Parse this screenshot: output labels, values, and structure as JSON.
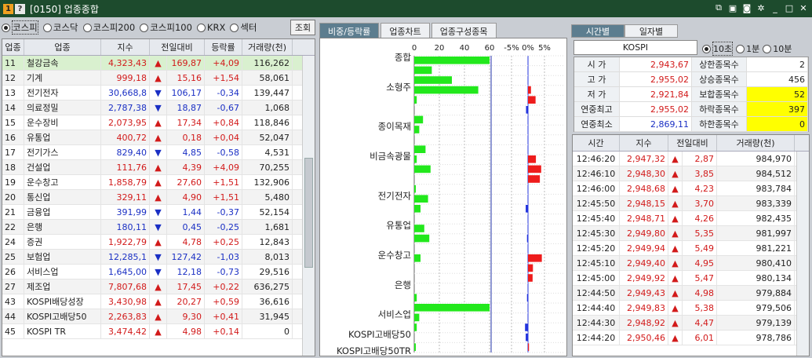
{
  "window": {
    "badge_one": "1",
    "badge_q": "?",
    "title": "[0150] 업종종합"
  },
  "market_radios": [
    {
      "label": "코스피",
      "selected": true
    },
    {
      "label": "코스닥",
      "selected": false
    },
    {
      "label": "코스피200",
      "selected": false
    },
    {
      "label": "코스피100",
      "selected": false
    },
    {
      "label": "KRX",
      "selected": false
    },
    {
      "label": "섹터",
      "selected": false
    }
  ],
  "query_button": "조회",
  "left_table": {
    "headers": [
      "업종",
      "업종",
      "지수",
      "전일대비",
      "등락률",
      "거래량(천)"
    ],
    "rows": [
      {
        "code": "11",
        "name": "철강금속",
        "index": "4,323,43",
        "dir": "up",
        "change": "169,87",
        "rate": "+4,09",
        "volume": "116,262"
      },
      {
        "code": "12",
        "name": "기계",
        "index": "999,18",
        "dir": "up",
        "change": "15,16",
        "rate": "+1,54",
        "volume": "58,061"
      },
      {
        "code": "13",
        "name": "전기전자",
        "index": "30,668,8",
        "dir": "down",
        "change": "106,17",
        "rate": "-0,34",
        "volume": "139,447"
      },
      {
        "code": "14",
        "name": "의료정밀",
        "index": "2,787,38",
        "dir": "down",
        "change": "18,87",
        "rate": "-0,67",
        "volume": "1,068"
      },
      {
        "code": "15",
        "name": "운수장비",
        "index": "2,073,95",
        "dir": "up",
        "change": "17,34",
        "rate": "+0,84",
        "volume": "118,846"
      },
      {
        "code": "16",
        "name": "유통업",
        "index": "400,72",
        "dir": "up",
        "change": "0,18",
        "rate": "+0,04",
        "volume": "52,047"
      },
      {
        "code": "17",
        "name": "전기가스",
        "index": "829,40",
        "dir": "down",
        "change": "4,85",
        "rate": "-0,58",
        "volume": "4,531"
      },
      {
        "code": "18",
        "name": "건설업",
        "index": "111,76",
        "dir": "up",
        "change": "4,39",
        "rate": "+4,09",
        "volume": "70,255"
      },
      {
        "code": "19",
        "name": "운수창고",
        "index": "1,858,79",
        "dir": "up",
        "change": "27,60",
        "rate": "+1,51",
        "volume": "132,906"
      },
      {
        "code": "20",
        "name": "통신업",
        "index": "329,11",
        "dir": "up",
        "change": "4,90",
        "rate": "+1,51",
        "volume": "5,480"
      },
      {
        "code": "21",
        "name": "금융업",
        "index": "391,99",
        "dir": "down",
        "change": "1,44",
        "rate": "-0,37",
        "volume": "52,154"
      },
      {
        "code": "22",
        "name": "은행",
        "index": "180,11",
        "dir": "down",
        "change": "0,45",
        "rate": "-0,25",
        "volume": "1,681"
      },
      {
        "code": "24",
        "name": "증권",
        "index": "1,922,79",
        "dir": "up",
        "change": "4,78",
        "rate": "+0,25",
        "volume": "12,843"
      },
      {
        "code": "25",
        "name": "보험업",
        "index": "12,285,1",
        "dir": "down",
        "change": "127,42",
        "rate": "-1,03",
        "volume": "8,013"
      },
      {
        "code": "26",
        "name": "서비스업",
        "index": "1,645,00",
        "dir": "down",
        "change": "12,18",
        "rate": "-0,73",
        "volume": "29,516"
      },
      {
        "code": "27",
        "name": "제조업",
        "index": "7,807,68",
        "dir": "up",
        "change": "17,45",
        "rate": "+0,22",
        "volume": "636,275"
      },
      {
        "code": "43",
        "name": "KOSPI배당성장",
        "index": "3,430,98",
        "dir": "up",
        "change": "20,27",
        "rate": "+0,59",
        "volume": "36,616"
      },
      {
        "code": "44",
        "name": "KOSPI고배당50",
        "index": "2,263,83",
        "dir": "up",
        "change": "9,30",
        "rate": "+0,41",
        "volume": "31,945"
      },
      {
        "code": "45",
        "name": "KOSPI TR",
        "index": "3,474,42",
        "dir": "up",
        "change": "4,98",
        "rate": "+0,14",
        "volume": "0"
      }
    ]
  },
  "arrows": {
    "up": "▲",
    "down": "▼"
  },
  "mid_tabs": [
    "비중/등락률",
    "업종차트",
    "업종구성종목"
  ],
  "chart_data": {
    "type": "bar",
    "left_axis_ticks": [
      "0",
      "20",
      "40",
      "60"
    ],
    "right_axis_ticks": [
      "-5%",
      "0%",
      "5%"
    ],
    "category_labels": [
      "종합",
      "소형주",
      "종이목재",
      "비금속광물",
      "전기전자",
      "유통업",
      "운수창고",
      "은행",
      "서비스업",
      "KOSPI고배당50",
      "KOSPI고배당50TR"
    ],
    "weight_bars": [
      60,
      14,
      30,
      51,
      2,
      0,
      7,
      4,
      0,
      9,
      2,
      13,
      0,
      1,
      11,
      5,
      0,
      8,
      12,
      0,
      5,
      0,
      0,
      0,
      2,
      60,
      4,
      2,
      0,
      1
    ],
    "rate_bars": [
      0,
      0,
      0,
      0.9,
      2.3,
      -0.6,
      0,
      0,
      0,
      0,
      2.4,
      4.0,
      3.6,
      0,
      0,
      -0.7,
      0,
      0,
      -0.3,
      0,
      4.2,
      1.5,
      1.4,
      0,
      -0.3,
      0,
      0,
      -0.9,
      -0.7,
      0.3
    ]
  },
  "right_tabs": [
    "시간별",
    "일자별"
  ],
  "index_name": "KOSPI",
  "interval_radios": [
    {
      "label": "10초",
      "selected": true
    },
    {
      "label": "1분",
      "selected": false
    },
    {
      "label": "10분",
      "selected": false
    }
  ],
  "summary": [
    {
      "label": "시 가",
      "value": "2,943,67",
      "color": "up",
      "label2": "상한종목수",
      "value2": "2",
      "hl": false
    },
    {
      "label": "고 가",
      "value": "2,955,02",
      "color": "up",
      "label2": "상승종목수",
      "value2": "456",
      "hl": false
    },
    {
      "label": "저 가",
      "value": "2,921,84",
      "color": "up",
      "label2": "보합종목수",
      "value2": "52",
      "hl": true
    },
    {
      "label": "연중최고",
      "value": "2,955,02",
      "color": "up",
      "label2": "하락종목수",
      "value2": "397",
      "hl": true
    },
    {
      "label": "연중최소",
      "value": "2,869,11",
      "color": "dn",
      "label2": "하한종목수",
      "value2": "0",
      "hl": true
    }
  ],
  "time_table": {
    "headers": [
      "시간",
      "지수",
      "전일대비",
      "거래량(천)"
    ],
    "rows": [
      {
        "time": "12:46:20",
        "index": "2,947,32",
        "change": "2,87",
        "volume": "984,970"
      },
      {
        "time": "12:46:10",
        "index": "2,948,30",
        "change": "3,85",
        "volume": "984,512"
      },
      {
        "time": "12:46:00",
        "index": "2,948,68",
        "change": "4,23",
        "volume": "983,784"
      },
      {
        "time": "12:45:50",
        "index": "2,948,15",
        "change": "3,70",
        "volume": "983,339"
      },
      {
        "time": "12:45:40",
        "index": "2,948,71",
        "change": "4,26",
        "volume": "982,435"
      },
      {
        "time": "12:45:30",
        "index": "2,949,80",
        "change": "5,35",
        "volume": "981,997"
      },
      {
        "time": "12:45:20",
        "index": "2,949,94",
        "change": "5,49",
        "volume": "981,221"
      },
      {
        "time": "12:45:10",
        "index": "2,949,40",
        "change": "4,95",
        "volume": "980,410"
      },
      {
        "time": "12:45:00",
        "index": "2,949,92",
        "change": "5,47",
        "volume": "980,134"
      },
      {
        "time": "12:44:50",
        "index": "2,949,43",
        "change": "4,98",
        "volume": "979,884"
      },
      {
        "time": "12:44:40",
        "index": "2,949,83",
        "change": "5,38",
        "volume": "979,506"
      },
      {
        "time": "12:44:30",
        "index": "2,948,92",
        "change": "4,47",
        "volume": "979,139"
      },
      {
        "time": "12:44:20",
        "index": "2,950,46",
        "change": "6,01",
        "volume": "978,786"
      }
    ]
  },
  "colors": {
    "up": "#d21a1a",
    "down": "#1a2fc4",
    "bar_green": "#22e81c",
    "bar_red": "#ee1c1c",
    "bar_blue": "#2233dd",
    "highlight": "#ffff00",
    "title_bg": "#1d4b2d",
    "tab_active": "#5c7d8f"
  }
}
